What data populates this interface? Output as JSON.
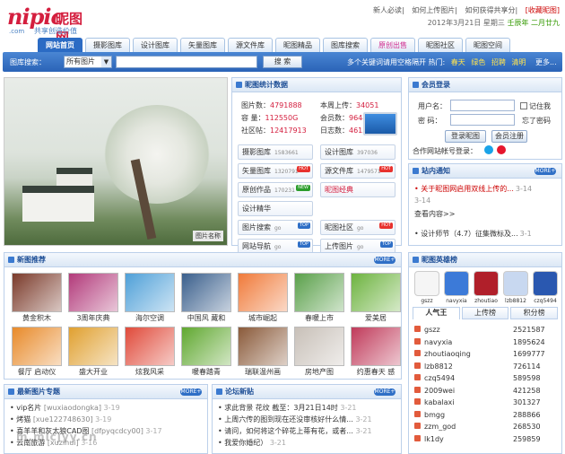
{
  "logo": {
    "wordmark": "nipic",
    "cn": "昵图网",
    "com": ".com",
    "slogan": "共享创造价值"
  },
  "toplinks": [
    "新人必读",
    "如何上传图片",
    "如何获得共享分",
    "[收藏昵图]"
  ],
  "datebar": {
    "date": "2012年3月21日",
    "weekday": "星期三",
    "lunar": "壬辰年  二月廿九"
  },
  "nav": [
    "网站首页",
    "摄影图库",
    "设计图库",
    "矢量图库",
    "源文件库",
    "昵图精品",
    "图库搜索",
    "原创出售",
    "昵图社区",
    "昵图空间"
  ],
  "search": {
    "label": "图库搜索：",
    "select": "所有图片",
    "button": "搜 索",
    "hint": "多个关键词请用空格隔开 热门:",
    "hot": [
      "春天",
      "绿色",
      "招聘",
      "清明"
    ],
    "more": "更多..."
  },
  "banner": {
    "label": "图片名称"
  },
  "stats": {
    "title": "昵图统计数据",
    "left": [
      {
        "k": "图片数：",
        "v": "4791888"
      },
      {
        "k": "容  量：",
        "v": "112550G"
      },
      {
        "k": "社区帖：",
        "v": "12417913"
      }
    ],
    "right": [
      {
        "k": "本周上传：",
        "v": "34051"
      },
      {
        "k": "会员数：",
        "v": "9644446"
      },
      {
        "k": "日志数：",
        "v": "46130"
      }
    ],
    "cells": [
      {
        "label": "摄影图库",
        "num": "1583661",
        "badge": ""
      },
      {
        "label": "设计图库",
        "num": "397036",
        "badge": ""
      },
      {
        "label": "矢量图库",
        "num": "1320791",
        "badge": "HOT"
      },
      {
        "label": "源文件库",
        "num": "1479571",
        "badge": "HOT"
      },
      {
        "label": "原创作品",
        "num": "170231",
        "badge": "NEW"
      },
      {
        "label": "昵图经典",
        "num": "",
        "badge": ""
      },
      {
        "label": "设计精华",
        "num": "",
        "badge": ""
      },
      {
        "label": "",
        "num": "",
        "badge": ""
      },
      {
        "label": "图片搜索",
        "num": "go",
        "badge": "TOP"
      },
      {
        "label": "昵图社区",
        "num": "go",
        "badge": "HOT"
      },
      {
        "label": "网站导航",
        "num": "go",
        "badge": "TOP"
      },
      {
        "label": "上传图片",
        "num": "go",
        "badge": "TOP"
      }
    ]
  },
  "login": {
    "title": "会员登录",
    "user": "用户名：",
    "pass": "密  码：",
    "remember": "记住我",
    "forgot": "忘了密码",
    "login_btn": "登录昵图",
    "reg_btn": "会员注册",
    "partner": "合作网站帐号登录："
  },
  "notice": {
    "title": "站内通知",
    "more": "MORE+",
    "items": [
      {
        "t": "关于昵图网启用双线上传的...",
        "d": "3-14"
      },
      {
        "t": "3-14",
        "d": ""
      },
      {
        "t": "查看内容>>",
        "d": ""
      },
      {
        "t": "设计师节（4.7）征集微标及...",
        "d": "3-1"
      }
    ]
  },
  "newpic": {
    "title": "新图推荐",
    "more": "MORE+",
    "captions": [
      "黄金积木",
      "3周年庆典",
      "海尔空调",
      "中国风 藏和",
      "城市崛起",
      "春暖上市",
      "爱美居",
      "餐厅 启动仪",
      "盛大开业",
      "炫我风采",
      "暖春踏青",
      "瑞联温州画",
      "房地产图",
      "约惠春天 感"
    ]
  },
  "hero": {
    "title": "昵图英雄榜",
    "avatars": [
      "gszz",
      "navyxia",
      "zhoutiao",
      "lzb8812",
      "czq5494"
    ],
    "tabs": [
      "人气王",
      "上传榜",
      "积分榜"
    ],
    "rank": [
      {
        "n": "gszz",
        "v": "2521587"
      },
      {
        "n": "navyxia",
        "v": "1895624"
      },
      {
        "n": "zhoutiaoqing",
        "v": "1699777"
      },
      {
        "n": "lzb8812",
        "v": "726114"
      },
      {
        "n": "czq5494",
        "v": "589598"
      },
      {
        "n": "2009wei",
        "v": "421258"
      },
      {
        "n": "kabalaxi",
        "v": "301327"
      },
      {
        "n": "bmgg",
        "v": "288866"
      },
      {
        "n": "zzm_god",
        "v": "268530"
      },
      {
        "n": "lk1dy",
        "v": "259859"
      }
    ]
  },
  "special": {
    "title": "最新图片专题",
    "more": "MORE+",
    "items": [
      {
        "t": "vip名片",
        "s": "[wuxiaodongka]",
        "d": "3-19"
      },
      {
        "t": "烤猫",
        "s": "[xue122748630]",
        "d": "3-19"
      },
      {
        "t": "喜羊羊和灰太狼CAD图",
        "s": "[dfpyqcdcy00]",
        "d": "3-17"
      },
      {
        "t": "云南旅游",
        "s": "[xuzihui]",
        "d": "3-16"
      }
    ]
  },
  "forum": {
    "title": "论坛新贴",
    "more": "MORE+",
    "items": [
      {
        "t": "求此背景 花纹 截至：3月21日14时",
        "d": "3-21"
      },
      {
        "t": "上周六传的图到现在还没审核好什么情...",
        "d": "3-21"
      },
      {
        "t": "请问，如何将这个碎花上蒂有花，或者...",
        "d": "3-21"
      },
      {
        "t": "我爱你婚纪）",
        "d": "3-21"
      }
    ]
  },
  "watermark": "m.mlcjyy.cn"
}
